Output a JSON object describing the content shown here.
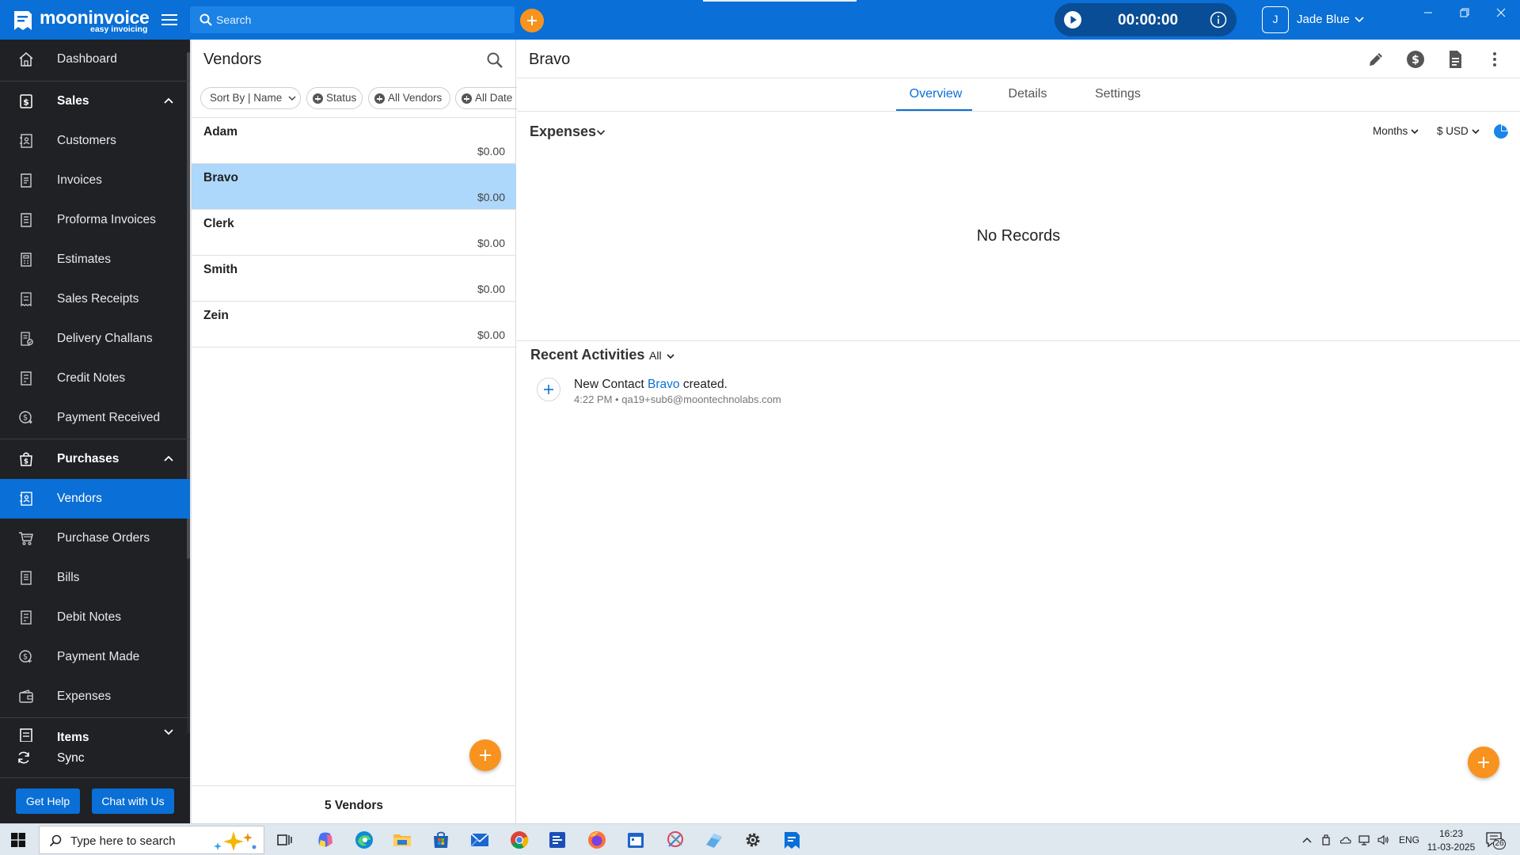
{
  "app": {
    "brand_name": "mooninvoice",
    "brand_tagline": "easy invoicing",
    "search_placeholder": "Search",
    "timer": "00:00:00",
    "user_initial": "J",
    "user_name": "Jade Blue"
  },
  "colors": {
    "primary": "#0a6fd6",
    "accent": "#f7931e",
    "sidebar_bg": "#1f2124",
    "selected_row": "#add7fb"
  },
  "sidebar": {
    "items": [
      {
        "label": "Dashboard",
        "icon": "home-icon"
      },
      {
        "label": "Sales",
        "icon": "dollar-document-icon",
        "section": true,
        "expanded": true
      },
      {
        "label": "Customers",
        "icon": "contact-book-icon"
      },
      {
        "label": "Invoices",
        "icon": "invoice-icon"
      },
      {
        "label": "Proforma Invoices",
        "icon": "proforma-icon"
      },
      {
        "label": "Estimates",
        "icon": "estimate-icon"
      },
      {
        "label": "Sales Receipts",
        "icon": "receipt-icon"
      },
      {
        "label": "Delivery Challans",
        "icon": "delivery-icon"
      },
      {
        "label": "Credit Notes",
        "icon": "credit-note-icon"
      },
      {
        "label": "Payment Received",
        "icon": "payment-received-icon"
      },
      {
        "label": "Purchases",
        "icon": "shopping-bag-icon",
        "section": true,
        "expanded": true
      },
      {
        "label": "Vendors",
        "icon": "vendor-icon",
        "active": true
      },
      {
        "label": "Purchase Orders",
        "icon": "cart-icon"
      },
      {
        "label": "Bills",
        "icon": "bill-icon"
      },
      {
        "label": "Debit Notes",
        "icon": "debit-note-icon"
      },
      {
        "label": "Payment Made",
        "icon": "payment-made-icon"
      },
      {
        "label": "Expenses",
        "icon": "wallet-icon"
      },
      {
        "label": "Items",
        "icon": "items-icon",
        "section": true,
        "expanded": false
      }
    ],
    "sync_label": "Sync",
    "get_help_label": "Get Help",
    "chat_label": "Chat with Us"
  },
  "vendors_panel": {
    "title": "Vendors",
    "filters": {
      "sort": "Sort By | Name",
      "status": "Status",
      "vendors": "All Vendors",
      "date": "All Date"
    },
    "vendors": [
      {
        "name": "Adam",
        "amount": "$0.00"
      },
      {
        "name": "Bravo",
        "amount": "$0.00",
        "selected": true
      },
      {
        "name": "Clerk",
        "amount": "$0.00"
      },
      {
        "name": "Smith",
        "amount": "$0.00"
      },
      {
        "name": "Zein",
        "amount": "$0.00"
      }
    ],
    "count_label": "5 Vendors"
  },
  "detail": {
    "title": "Bravo",
    "tabs": [
      "Overview",
      "Details",
      "Settings"
    ],
    "active_tab": "Overview",
    "expenses_title": "Expenses",
    "period": "Months",
    "currency": "$ USD",
    "no_records": "No Records",
    "recent_title": "Recent Activities",
    "recent_filter": "All",
    "activity": {
      "prefix": "New Contact",
      "link": "Bravo",
      "suffix": "created.",
      "time": "4:22 PM",
      "separator": "•",
      "email": "qa19+sub6@moontechnolabs.com"
    }
  },
  "taskbar": {
    "search_text": "Type here to search",
    "language": "ENG",
    "time": "16:23",
    "date": "11-03-2025",
    "notification_count": "26"
  }
}
